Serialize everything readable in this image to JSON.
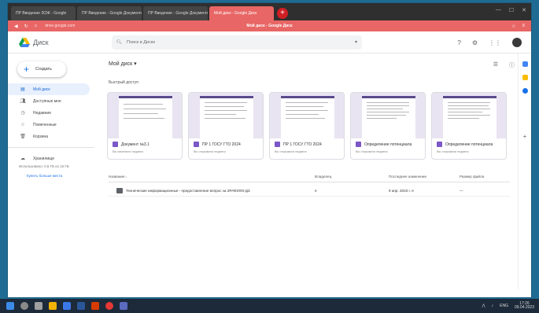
{
  "browser": {
    "tabs": [
      {
        "label": "ПР Введение ЗОЖ - Google"
      },
      {
        "label": "ПР Введение - Google Документы"
      },
      {
        "label": "ПР Введение - Google Документы"
      },
      {
        "label": "Мой диск - Google Диск"
      }
    ],
    "new_tab_label": "+",
    "url_text": "drive.google.com",
    "page_title": "Мой диск - Google Диск"
  },
  "app": {
    "logo_text": "Диск",
    "search_placeholder": "Поиск в Диске"
  },
  "sidebar": {
    "create_label": "Создать",
    "items": [
      {
        "label": "Мой диск",
        "icon": "drive-icon"
      },
      {
        "label": "Доступные мне",
        "icon": "shared-icon"
      },
      {
        "label": "Недавние",
        "icon": "clock-icon"
      },
      {
        "label": "Помеченные",
        "icon": "star-icon"
      },
      {
        "label": "Корзина",
        "icon": "trash-icon"
      }
    ],
    "storage_label": "Хранилище",
    "storage_text": "Использовано: 0,5 ГБ из 15 ГБ",
    "buy_text": "Купить больше места"
  },
  "main": {
    "breadcrumb": "Мой диск ▾",
    "quick_access_label": "Быстрый доступ",
    "cards": [
      {
        "name": "Документ №3.1",
        "sub": "Вы изменили недавно"
      },
      {
        "name": "ПР 1 ГОСУ ГТО 2024",
        "sub": "Вы открывали недавно"
      },
      {
        "name": "ПР 1 ГОСУ ГТО 2024",
        "sub": "Вы открывали недавно"
      },
      {
        "name": "Определение потенциала",
        "sub": "Вы открывали недавно"
      },
      {
        "name": "Определение потенциала",
        "sub": "Вы открывали недавно"
      }
    ],
    "table": {
      "headers": {
        "name": "Название ↓",
        "owner": "Владелец",
        "modified": "Последнее изменение",
        "size": "Размер файла"
      },
      "rows": [
        {
          "name": "Технические информационные - предоставление вопрос за ЗРАФ2ФО-ДЗ",
          "owner": "я",
          "modified": "9 апр. 2023 г. я",
          "size": "—"
        }
      ]
    }
  },
  "taskbar": {
    "tray_text": "ENG",
    "time": "17:26",
    "date": "09.04.2023"
  }
}
